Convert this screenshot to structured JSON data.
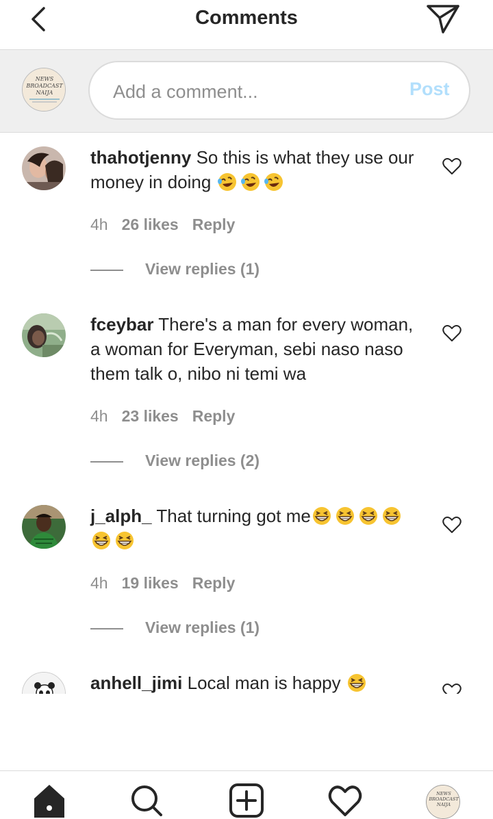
{
  "header": {
    "title": "Comments",
    "back_icon": "chevron-left-icon",
    "send_icon": "paper-plane-icon"
  },
  "composer": {
    "avatar_logo_text": [
      "NEWS",
      "BROADCAST",
      "NAIJA"
    ],
    "placeholder": "Add a comment...",
    "post_label": "Post",
    "post_color": "#b2dffc"
  },
  "comments": [
    {
      "username": "thahotjenny",
      "text": "So this is what they use our money in doing",
      "emoji": "rolling-on-floor-laughing",
      "emoji_count": 3,
      "time": "4h",
      "likes": "26 likes",
      "reply": "Reply",
      "view_replies": "View replies (1)"
    },
    {
      "username": "fceybar",
      "text": "There's a man for every woman, a woman for Everyman, sebi naso naso them talk o, nibo ni temi wa",
      "emoji": "",
      "emoji_count": 0,
      "time": "4h",
      "likes": "23 likes",
      "reply": "Reply",
      "view_replies": "View replies (2)"
    },
    {
      "username": "j_alph_",
      "text": "That turning got me",
      "emoji": "grinning-squinting-face",
      "emoji_count": 6,
      "time": "4h",
      "likes": "19 likes",
      "reply": "Reply",
      "view_replies": "View replies (1)"
    },
    {
      "username": "anhell_jimi",
      "text": "Local man is happy",
      "emoji": "grinning-squinting-face",
      "emoji_count": 1
    }
  ],
  "tabbar": {
    "items": [
      "home-icon",
      "search-icon",
      "new-post-icon",
      "activity-heart-icon",
      "profile-avatar"
    ],
    "profile_logo_text": [
      "NEWS",
      "BROADCAST",
      "NAIJA"
    ]
  },
  "colors": {
    "text": "#262626",
    "secondary": "#8e8e8e",
    "divider": "#dbdbdb",
    "composer_bg": "#efefef"
  }
}
